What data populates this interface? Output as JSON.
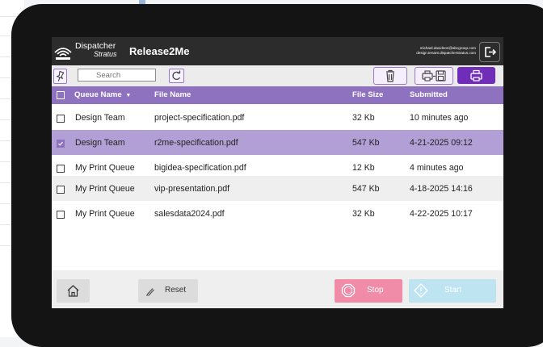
{
  "app": {
    "brand_line1": "Dispatcher",
    "brand_line2": "Stratus",
    "title": "Release2Me",
    "user_email": "michael.davidson@abcgroup.com",
    "user_tenant": "design.tenant.dispatcherstratus.com"
  },
  "toolbar": {
    "search_placeholder": "Search"
  },
  "table": {
    "columns": [
      "Queue Name",
      "File Name",
      "File Size",
      "Submitted"
    ],
    "rows": [
      {
        "queue": "Design Team",
        "file": "project-specification.pdf",
        "size": "32 Kb",
        "submitted": "10 minutes ago",
        "selected": false
      },
      {
        "queue": "Design Team",
        "file": "r2me-specification.pdf",
        "size": "547 Kb",
        "submitted": "4-21-2025 09:12",
        "selected": true
      },
      {
        "queue": "My Print Queue",
        "file": "bigidea-specification.pdf",
        "size": "12 Kb",
        "submitted": "4 minutes ago",
        "selected": false
      },
      {
        "queue": "My Print Queue",
        "file": "vip-presentation.pdf",
        "size": "547 Kb",
        "submitted": "4-18-2025 14:16",
        "selected": false
      },
      {
        "queue": "My Print Queue",
        "file": "salesdata2024.pdf",
        "size": "32 Kb",
        "submitted": "4-22-2025 10:17",
        "selected": false
      }
    ]
  },
  "footer": {
    "reset_label": "Reset",
    "stop_label": "Stop",
    "start_label": "Start"
  },
  "colors": {
    "accent": "#8e72c0",
    "accent_dark": "#6f2db8",
    "selected_row": "#b29fd5",
    "alt_row": "#efefef",
    "stop": "#f08ba8",
    "start": "#bde4f0"
  },
  "icons": {
    "logo": "dispatcher-logo-icon",
    "logout": "logout-icon",
    "pin": "pin-icon",
    "refresh": "refresh-icon",
    "trash": "trash-icon",
    "print_save": "print-save-icon",
    "print": "print-icon",
    "home": "home-icon",
    "reset": "pen-icon",
    "stop": "stop-icon",
    "start": "start-icon"
  }
}
